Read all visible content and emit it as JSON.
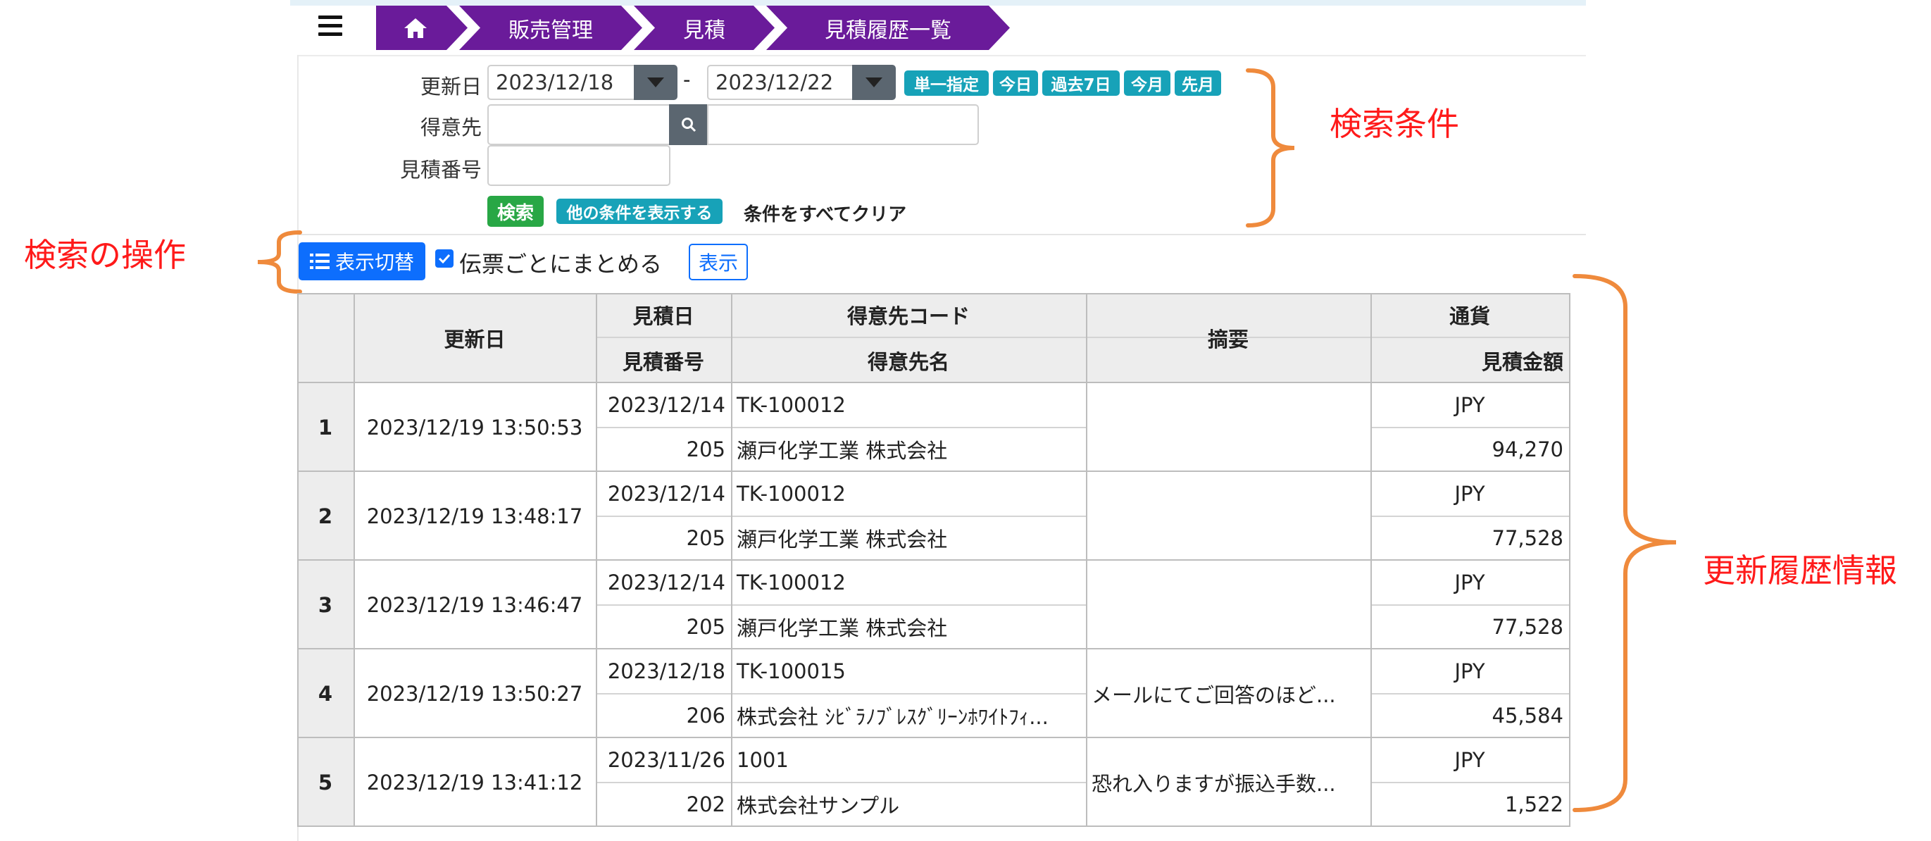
{
  "breadcrumb": {
    "home_icon": "home-icon",
    "items": [
      "販売管理",
      "見積",
      "見積履歴一覧"
    ],
    "color": "#6a1b9a"
  },
  "search": {
    "update_date_label": "更新日",
    "date_from": "2023/12/18",
    "date_sep": "-",
    "date_to": "2023/12/22",
    "quick_tags": [
      "単一指定",
      "今日",
      "過去7日",
      "今月",
      "先月"
    ],
    "customer_label": "得意先",
    "customer_code_value": "",
    "customer_name_value": "",
    "quote_no_label": "見積番号",
    "quote_no_value": "",
    "search_button": "検索",
    "more_conditions_button": "他の条件を表示する",
    "clear_link": "条件をすべてクリア"
  },
  "toolbar": {
    "toggle_view_button": "表示切替",
    "group_checkbox_label": "伝票ごとにまとめる",
    "group_checked": true,
    "show_button": "表示"
  },
  "annotations": {
    "search_conditions": "検索条件",
    "search_operations": "検索の操作",
    "history_info": "更新履歴情報",
    "color": "#ff1a1a",
    "bracket_color": "#ef8a3c"
  },
  "table": {
    "headers": {
      "updated_at": "更新日",
      "quote_date": "見積日",
      "quote_no": "見積番号",
      "customer_code": "得意先コード",
      "customer_name": "得意先名",
      "summary": "摘要",
      "currency": "通貨",
      "amount": "見積金額"
    },
    "rows": [
      {
        "no": "1",
        "updated_at": "2023/12/19 13:50:53",
        "quote_date": "2023/12/14",
        "quote_no": "205",
        "customer_code": "TK-100012",
        "customer_name": "瀬戸化学工業 株式会社",
        "summary": "",
        "currency": "JPY",
        "amount": "94,270"
      },
      {
        "no": "2",
        "updated_at": "2023/12/19 13:48:17",
        "quote_date": "2023/12/14",
        "quote_no": "205",
        "customer_code": "TK-100012",
        "customer_name": "瀬戸化学工業 株式会社",
        "summary": "",
        "currency": "JPY",
        "amount": "77,528"
      },
      {
        "no": "3",
        "updated_at": "2023/12/19 13:46:47",
        "quote_date": "2023/12/14",
        "quote_no": "205",
        "customer_code": "TK-100012",
        "customer_name": "瀬戸化学工業 株式会社",
        "summary": "",
        "currency": "JPY",
        "amount": "77,528"
      },
      {
        "no": "4",
        "updated_at": "2023/12/19 13:50:27",
        "quote_date": "2023/12/18",
        "quote_no": "206",
        "customer_code": "TK-100015",
        "customer_name": "株式会社 ｼﾋﾞﾗﾉﾌﾞﾚｽｸﾞﾘｰﾝﾎﾜｲﾄﾌｨ...",
        "summary": "メールにてご回答のほど...",
        "currency": "JPY",
        "amount": "45,584"
      },
      {
        "no": "5",
        "updated_at": "2023/12/19 13:41:12",
        "quote_date": "2023/11/26",
        "quote_no": "202",
        "customer_code": "1001",
        "customer_name": "株式会社サンプル",
        "summary": "恐れ入りますが振込手数...",
        "currency": "JPY",
        "amount": "1,522"
      }
    ]
  }
}
